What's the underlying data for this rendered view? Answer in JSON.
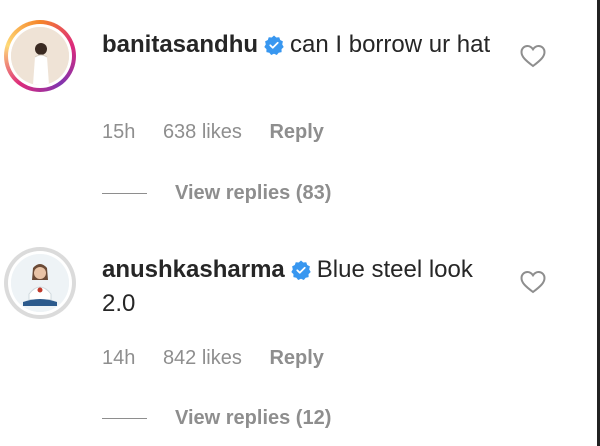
{
  "comments": [
    {
      "username": "banitasandhu",
      "text": "can I borrow ur hat",
      "time": "15h",
      "likes": "638 likes",
      "reply_label": "Reply",
      "view_replies": "View replies (83)"
    },
    {
      "username": "anushkasharma",
      "text": "Blue steel look 2.0",
      "time": "14h",
      "likes": "842 likes",
      "reply_label": "Reply",
      "view_replies": "View replies (12)"
    }
  ],
  "colors": {
    "verified": "#3897f0",
    "meta": "#8e8e8e",
    "text": "#262626"
  },
  "icons": {
    "verified": "verified-badge-icon",
    "like": "heart-outline-icon"
  }
}
